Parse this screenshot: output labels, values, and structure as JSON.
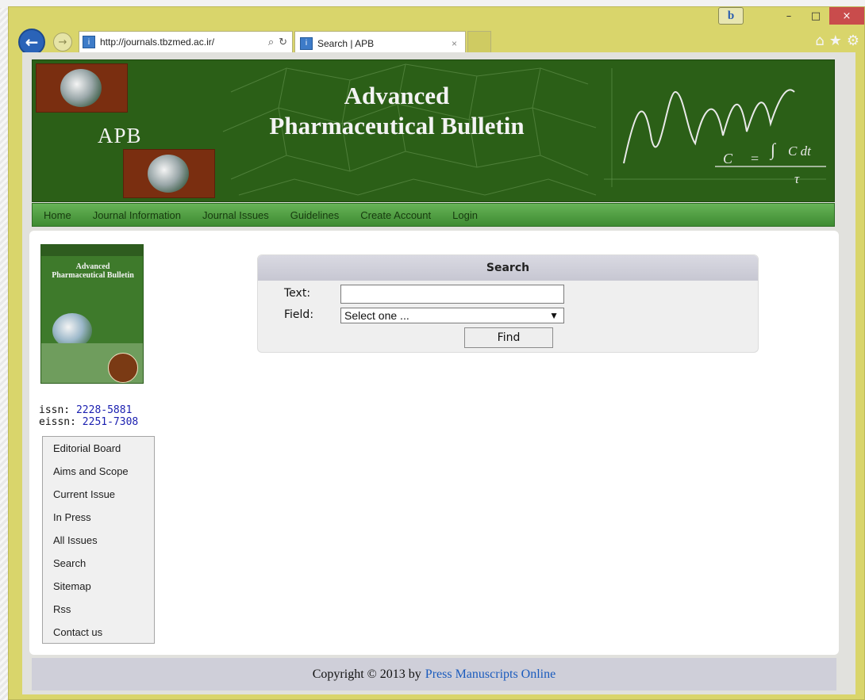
{
  "browser": {
    "address_url": "http://journals.tbzmed.ac.ir/",
    "tab_title": "Search | APB",
    "tab_close": "×",
    "bing_label": "b",
    "minimize": "–",
    "maximize": "□",
    "close": "×",
    "back_glyph": "←",
    "forward_glyph": "→",
    "search_glyph": "⌕",
    "refresh_glyph": "↻",
    "favicon_glyph": "i",
    "home_glyph": "⌂",
    "favorites_glyph": "★",
    "tools_glyph": "⚙"
  },
  "banner": {
    "apb_label": "APB",
    "title_line1": "Advanced",
    "title_line2": "Pharmaceutical Bulletin"
  },
  "menu": {
    "items": [
      "Home",
      "Journal Information",
      "Journal Issues",
      "Guidelines",
      "Create Account",
      "Login"
    ]
  },
  "cover": {
    "title_line1": "Advanced",
    "title_line2": "Pharmaceutical Bulletin"
  },
  "issn": {
    "issn_label": "issn:",
    "issn_value": "2228-5881",
    "eissn_label": "eissn:",
    "eissn_value": "2251-7308"
  },
  "sidebar": {
    "items": [
      "Editorial Board",
      "Aims and Scope",
      "Current Issue",
      "In Press",
      "All Issues",
      "Search",
      "Sitemap",
      "Rss",
      "Contact us"
    ]
  },
  "search": {
    "heading": "Search",
    "text_label": "Text:",
    "text_value": "",
    "field_label": "Field:",
    "field_selected": "Select one ...",
    "find_label": "Find"
  },
  "footer": {
    "text": "Copyright © 2013 by",
    "link": "Press Manuscripts Online"
  }
}
